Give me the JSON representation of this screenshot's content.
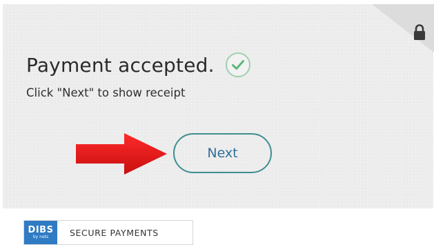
{
  "payment": {
    "title": "Payment accepted.",
    "instruction": "Click \"Next\" to show receipt",
    "status_icon": "check-circle-icon",
    "lock_icon": "lock-icon"
  },
  "actions": {
    "next_label": "Next",
    "arrow_icon": "red-arrow-right-icon"
  },
  "footer": {
    "logo_text": "DIBS",
    "logo_subtext": "by nets",
    "secure_label": "SECURE PAYMENTS"
  },
  "colors": {
    "card_background": "#eeeeee",
    "button_border": "#3e8d8f",
    "button_text": "#2f6f9a",
    "check_color": "#5cb87a",
    "arrow_red": "#e11b1b",
    "logo_blue": "#2f7bc4"
  }
}
